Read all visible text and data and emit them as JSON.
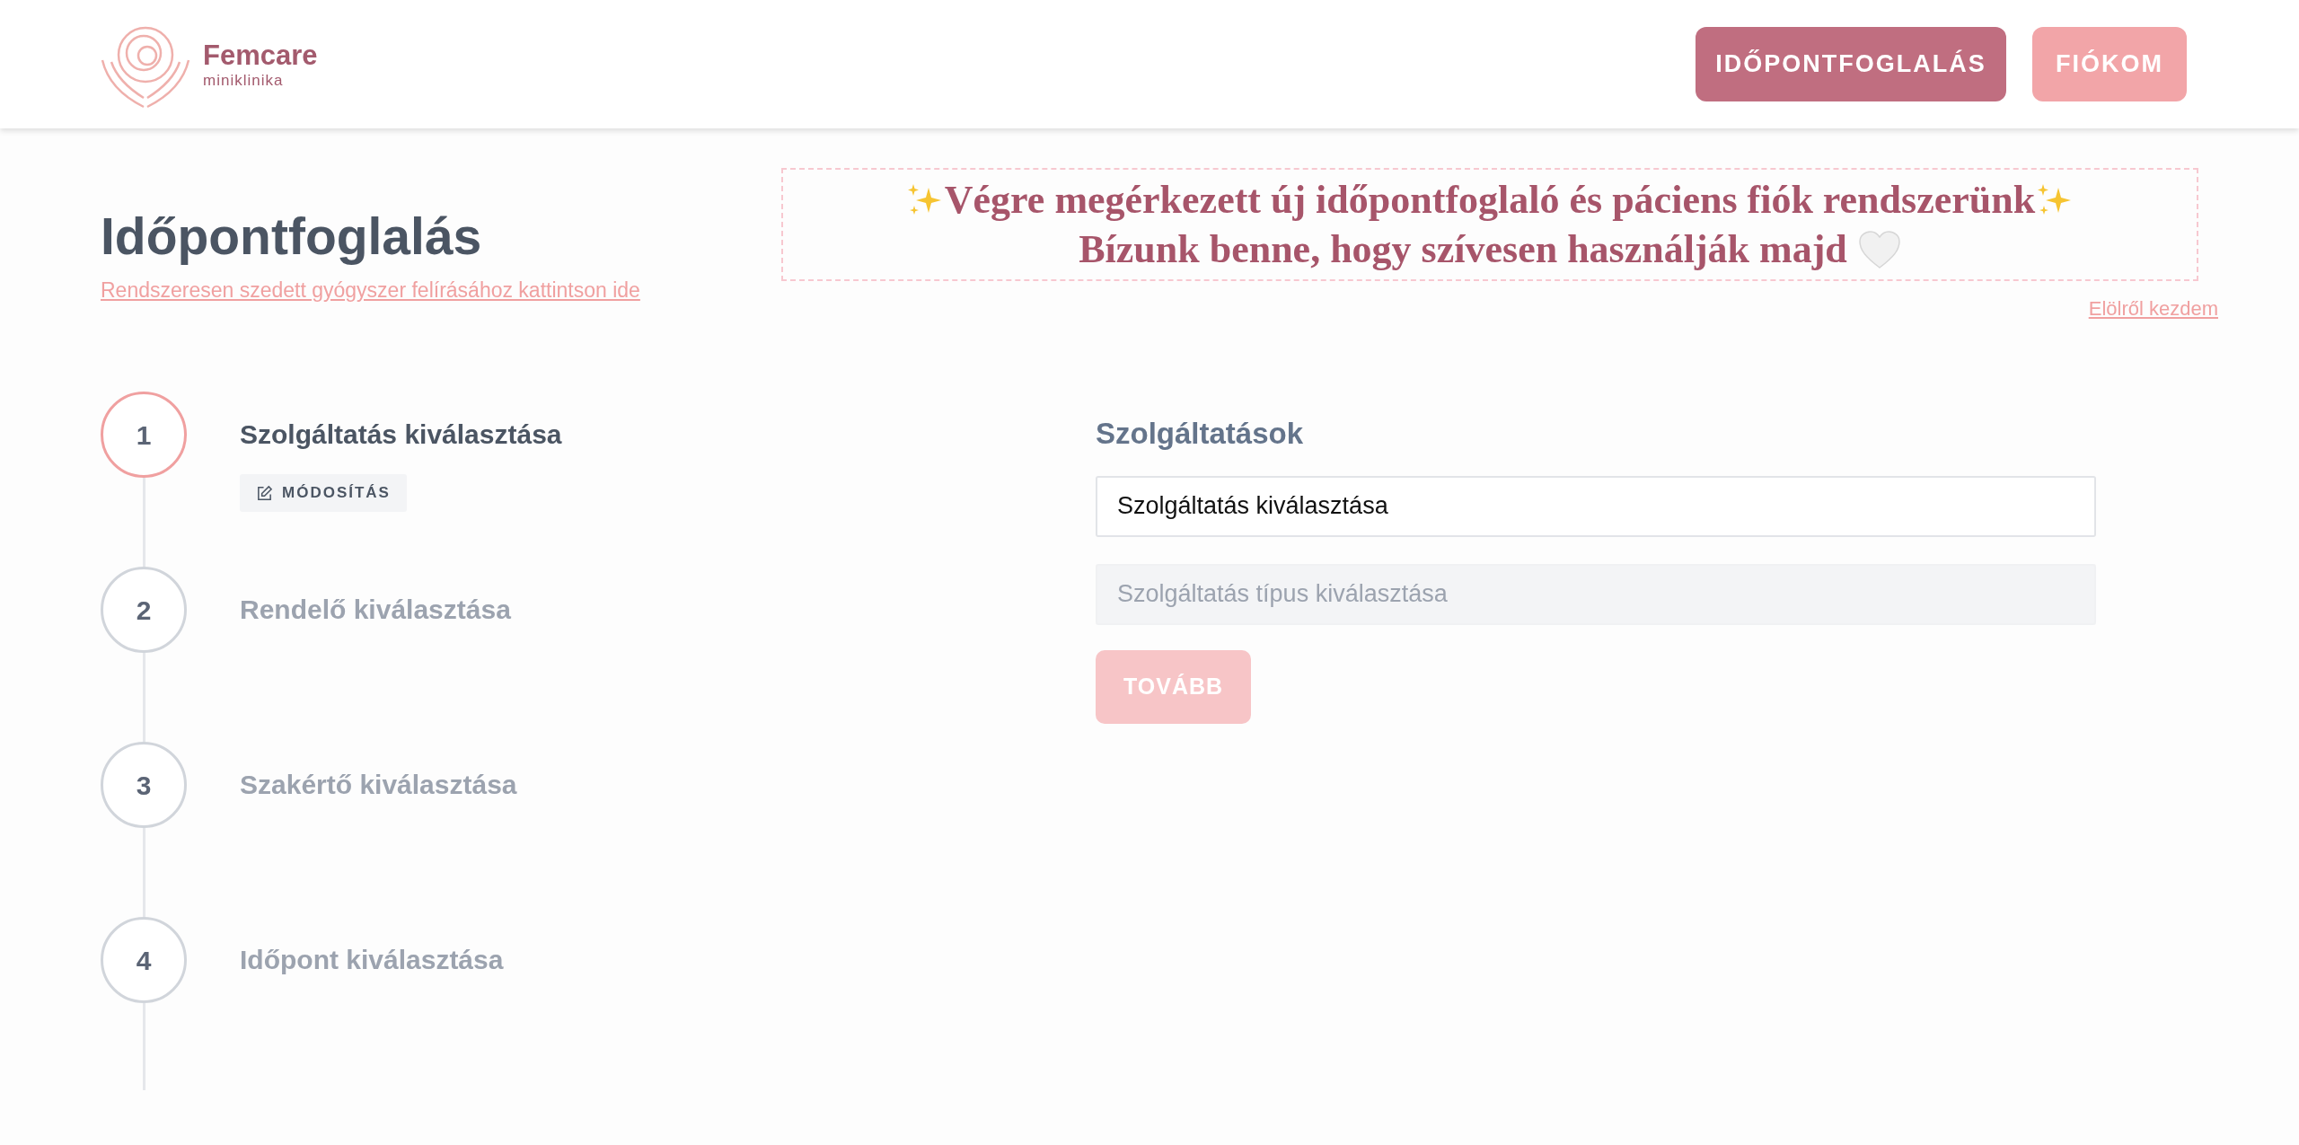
{
  "header": {
    "brand": {
      "name": "Femcare",
      "subtitle": "miniklinika"
    },
    "buttons": [
      {
        "label": "IDŐPONTFOGLALÁS",
        "kind": "primary"
      },
      {
        "label": "FIÓKOM",
        "kind": "secondary"
      }
    ]
  },
  "page": {
    "title": "Időpontfoglalás",
    "prescription_link": "Rendszeresen szedett gyógyszer felírásához kattintson ide"
  },
  "announcement": {
    "line_1": "Végre megérkezett új időpontfoglaló és páciens fiók rendszerünk",
    "line_2": "Bízunk benne, hogy szívesen használják majd"
  },
  "restart_link": "Elölről kezdem",
  "steps": [
    {
      "number": "1",
      "label": "Szolgáltatás kiválasztása",
      "selected": true,
      "edit_button": "MÓDOSÍTÁS"
    },
    {
      "number": "2",
      "label": "Rendelő kiválasztása",
      "selected": false
    },
    {
      "number": "3",
      "label": "Szakértő kiválasztása",
      "selected": false
    },
    {
      "number": "4",
      "label": "Időpont kiválasztása",
      "selected": false
    }
  ],
  "form": {
    "heading": "Szolgáltatások",
    "fields": [
      {
        "value": "Szolgáltatás kiválasztása",
        "disabled": false
      },
      {
        "placeholder": "Szolgáltatás típus kiválasztása",
        "disabled": true
      }
    ],
    "next_button": {
      "label": "TOVÁBB",
      "disabled": true
    }
  }
}
